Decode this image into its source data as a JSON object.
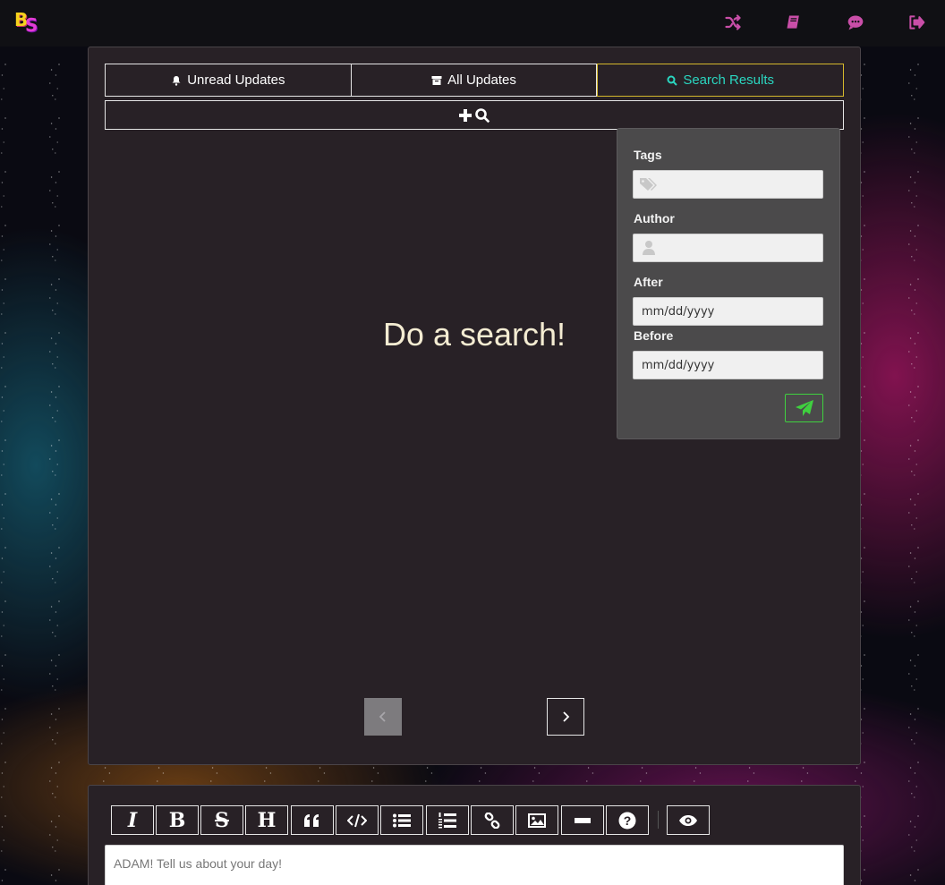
{
  "app": {
    "logo_text": "BS"
  },
  "nav": {
    "items": [
      {
        "icon": "shuffle-icon"
      },
      {
        "icon": "book-icon"
      },
      {
        "icon": "chat-icon"
      },
      {
        "icon": "sign-out-icon"
      }
    ],
    "icon_color": "#c94ea8"
  },
  "tabs": [
    {
      "label": "Unread Updates",
      "icon": "bell-icon",
      "active": false
    },
    {
      "label": "All Updates",
      "icon": "archive-icon",
      "active": false
    },
    {
      "label": "Search Results",
      "icon": "search-icon",
      "active": true
    }
  ],
  "main": {
    "empty_message": "Do a search!"
  },
  "search": {
    "tags_label": "Tags",
    "tags_value": "",
    "author_label": "Author",
    "author_value": "",
    "after_label": "After",
    "after_placeholder": "mm/dd/yyyy",
    "before_label": "Before",
    "before_placeholder": "mm/dd/yyyy",
    "submit_icon": "send-icon"
  },
  "composer": {
    "toolbar": [
      {
        "name": "italic",
        "glyph": "I"
      },
      {
        "name": "bold",
        "glyph": "B"
      },
      {
        "name": "strikethrough",
        "glyph": "S"
      },
      {
        "name": "heading",
        "glyph": "H"
      },
      {
        "name": "quote",
        "glyph": "“"
      },
      {
        "name": "code",
        "glyph": "</>"
      },
      {
        "name": "unordered-list",
        "glyph": ""
      },
      {
        "name": "ordered-list",
        "glyph": ""
      },
      {
        "name": "link",
        "glyph": ""
      },
      {
        "name": "image",
        "glyph": ""
      },
      {
        "name": "horizontal-rule",
        "glyph": ""
      },
      {
        "name": "help",
        "glyph": "?"
      },
      {
        "name": "preview",
        "glyph": ""
      }
    ],
    "placeholder": "ADAM! Tell us about your day!"
  },
  "colors": {
    "panel_bg": "#282126",
    "active_tab_border": "#d4b82c",
    "active_tab_text": "#2ad6c0",
    "submit_accent": "#3fd13f",
    "empty_message": "#f4ecd2"
  }
}
